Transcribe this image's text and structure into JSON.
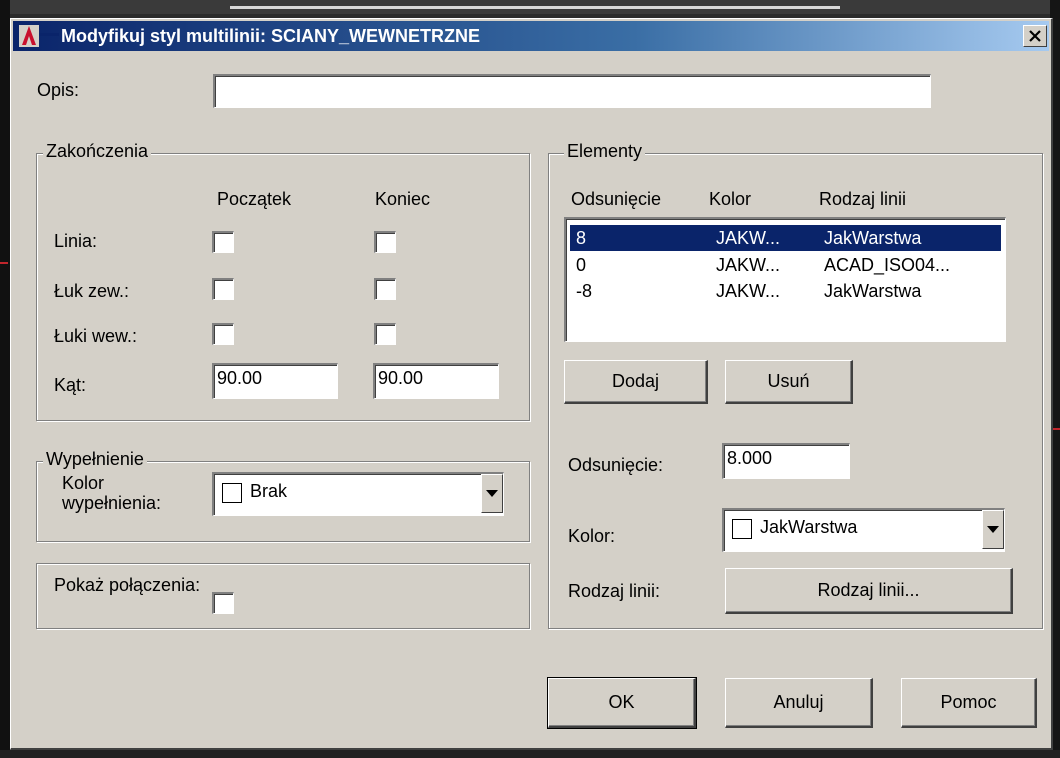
{
  "window": {
    "title": "Modyfikuj styl multilinii: SCIANY_WEWNETRZNE"
  },
  "description": {
    "label": "Opis:",
    "value": ""
  },
  "caps": {
    "group_title": "Zakończenia",
    "col_start": "Początek",
    "col_end": "Koniec",
    "rows": [
      {
        "label": "Linia:",
        "start_checked": false,
        "end_checked": false
      },
      {
        "label": "Łuk zew.:",
        "start_checked": false,
        "end_checked": false
      },
      {
        "label": "Łuki wew.:",
        "start_checked": false,
        "end_checked": false
      }
    ],
    "angle_label": "Kąt:",
    "angle_start": "90.00",
    "angle_end": "90.00"
  },
  "fill": {
    "group_title": "Wypełnienie",
    "color_label": "Kolor wypełnienia:",
    "color_value": "Brak"
  },
  "joints": {
    "label": "Pokaż połączenia:",
    "checked": false
  },
  "elements": {
    "group_title": "Elementy",
    "headers": [
      "Odsunięcie",
      "Kolor",
      "Rodzaj linii"
    ],
    "rows": [
      {
        "offset": "8",
        "color": "JAKW...",
        "linetype": "JakWarstwa",
        "selected": true
      },
      {
        "offset": "0",
        "color": "JAKW...",
        "linetype": "ACAD_ISO04...",
        "selected": false
      },
      {
        "offset": "-8",
        "color": "JAKW...",
        "linetype": "JakWarstwa",
        "selected": false
      }
    ],
    "add_label": "Dodaj",
    "remove_label": "Usuń",
    "offset_label": "Odsunięcie:",
    "offset_value": "8.000",
    "color_label": "Kolor:",
    "color_value": "JakWarstwa",
    "linetype_label": "Rodzaj linii:",
    "linetype_button": "Rodzaj linii..."
  },
  "footer": {
    "ok_label": "OK",
    "cancel_label": "Anuluj",
    "help_label": "Pomoc"
  },
  "colors": {
    "title_bar": "#0a246a",
    "selection": "#0a246a",
    "face": "#d4d0c8"
  }
}
